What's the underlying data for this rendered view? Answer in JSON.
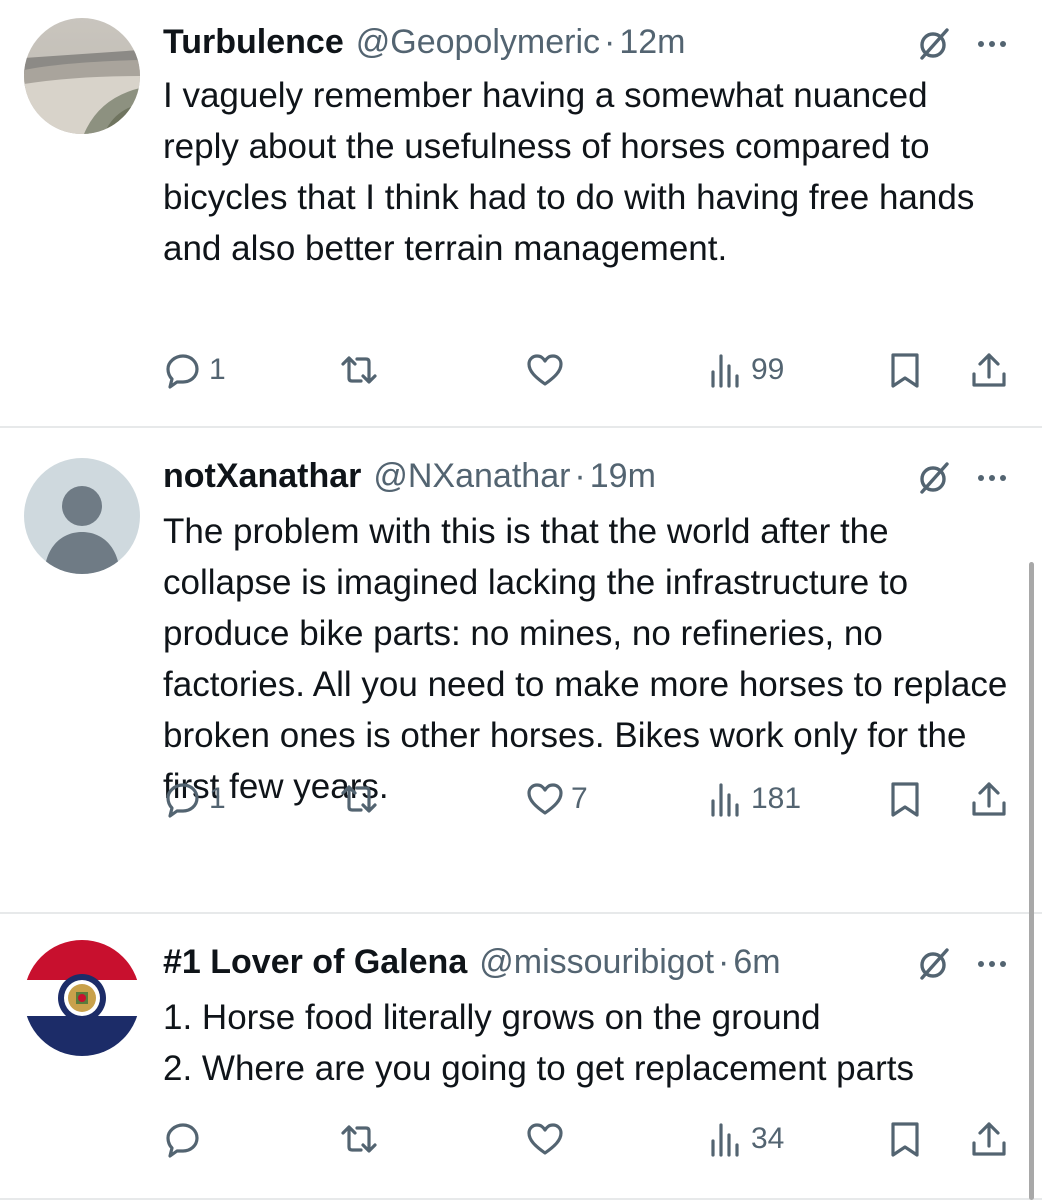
{
  "tweets": [
    {
      "display_name": "Turbulence",
      "handle": "@Geopolymeric",
      "separator": "·",
      "time": "12m",
      "avatar": "beach-photo-avatar",
      "text": "I vaguely remember having a somewhat nuanced reply about the usefulness of horses compared to bicycles that I think had to do with having free hands and also better terrain management.",
      "replies": "1",
      "reposts": "",
      "likes": "",
      "views": "99"
    },
    {
      "display_name": "notXanathar",
      "handle": "@NXanathar",
      "separator": "·",
      "time": "19m",
      "avatar": "default-user-avatar",
      "text": "The problem with this is that the world after the collapse is imagined lacking the infrastructure to produce bike parts: no mines, no refineries, no factories. All you need to make more horses to replace broken ones is other horses. Bikes work only for the first few years.",
      "replies": "1",
      "reposts": "",
      "likes": "7",
      "views": "181"
    },
    {
      "display_name": "#1 Lover of Galena",
      "handle": "@missouribigot",
      "separator": "·",
      "time": "6m",
      "avatar": "missouri-flag-avatar",
      "text_lines": [
        "1. Horse food literally grows on the ground",
        "2. Where are you going to get replacement parts"
      ],
      "replies": "",
      "reposts": "",
      "likes": "",
      "views": "34"
    }
  ],
  "colors": {
    "text_primary": "#0f1419",
    "text_secondary": "#536471",
    "divider": "#e7e9ea"
  },
  "icons": [
    "reply-icon",
    "repost-icon",
    "like-icon",
    "views-icon",
    "bookmark-icon",
    "share-icon",
    "grok-icon",
    "more-icon"
  ]
}
